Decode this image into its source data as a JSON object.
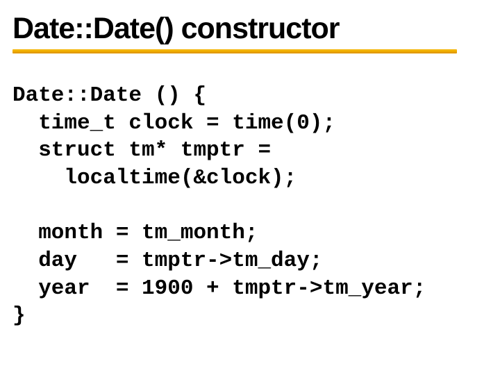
{
  "title": "Date::Date() constructor",
  "code": {
    "l1": "Date::Date () {",
    "l2": "  time_t clock = time(0);",
    "l3": "  struct tm* tmptr =",
    "l4": "    localtime(&clock);",
    "blank": "",
    "l5": "  month = tm_month;",
    "l6": "  day   = tmptr->tm_day;",
    "l7": "  year  = 1900 + tmptr->tm_year;",
    "l8": "}"
  }
}
